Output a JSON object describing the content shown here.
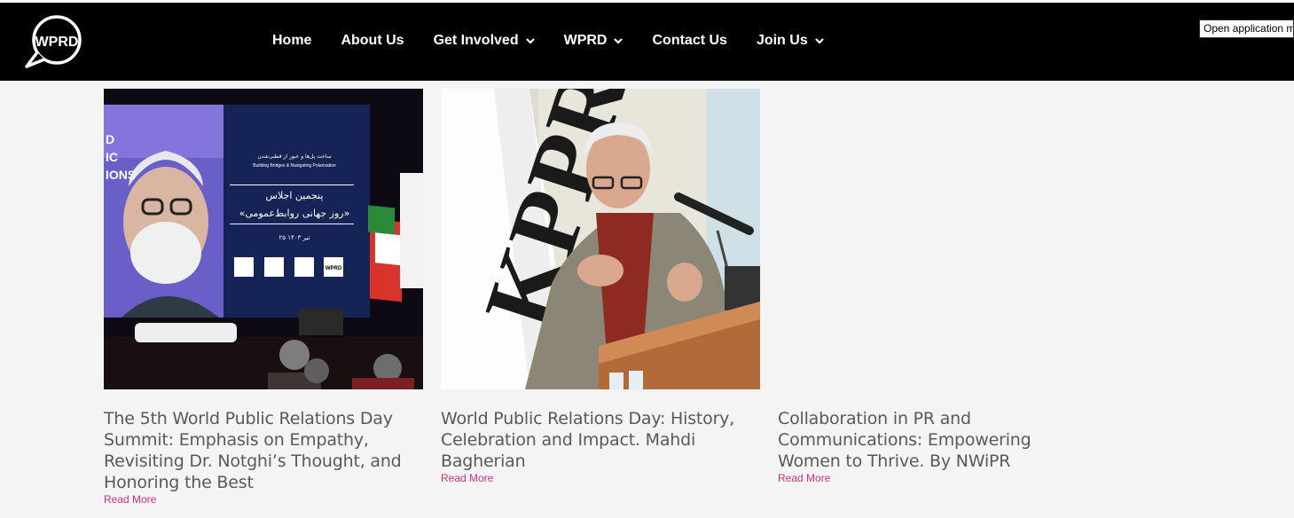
{
  "nav": {
    "logo_text": "WPRD",
    "items": [
      {
        "label": "Home",
        "dropdown": false
      },
      {
        "label": "About Us",
        "dropdown": false
      },
      {
        "label": "Get Involved",
        "dropdown": true
      },
      {
        "label": "WPRD",
        "dropdown": true
      },
      {
        "label": "Contact Us",
        "dropdown": false
      },
      {
        "label": "Join Us",
        "dropdown": true
      }
    ]
  },
  "tooltip": "Open application m",
  "posts": [
    {
      "title": "The 5th World Public Relations Day Summit: Emphasis on Empathy, Revisiting Dr. Notghi’s Thought, and Honoring the Best",
      "read_more": "Read More",
      "image": {
        "screen_subtitle_fa": "ساخت پل‌ها و عبور از قطبی‌شدن",
        "screen_subtitle_en": "Building Bridges & Navigating Polarisation",
        "screen_heading_fa": "پنجمین اجلاس",
        "screen_title_fa": "«روز جهانی روابط‌عمومی»",
        "screen_date_fa": "۲۵ تیر ۱۴۰۳",
        "screen_logo_text": "WPRD",
        "left_text": "D\nIC\nIONS"
      }
    },
    {
      "title": "World Public Relations Day: History, Celebration and Impact. Mahdi Bagherian",
      "read_more": "Read More",
      "image": {
        "banner_text": "KPPR"
      }
    },
    {
      "title": "Collaboration in PR and Communications: Empowering Women to Thrive. By NWiPR",
      "read_more": "Read More"
    }
  ],
  "colors": {
    "header_bg": "#000000",
    "page_bg": "#f4f4f4",
    "title_text": "#595959",
    "read_more": "#d4317f"
  }
}
